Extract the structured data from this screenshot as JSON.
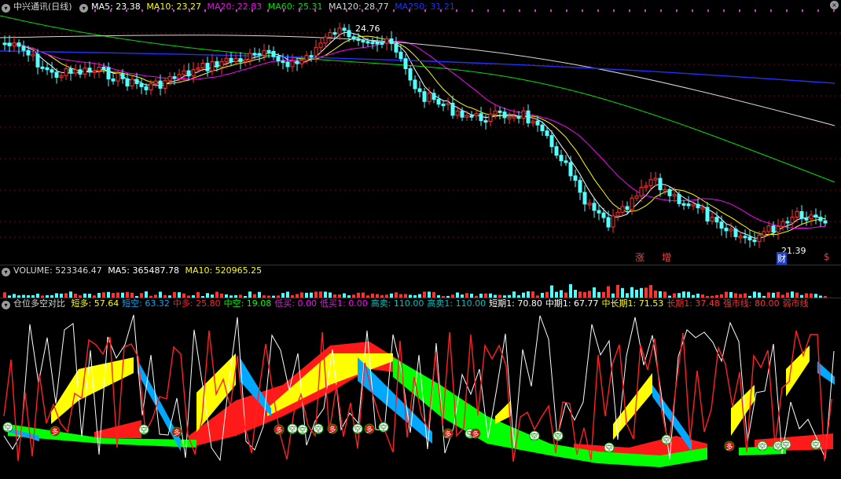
{
  "header": {
    "title": "中兴通讯(日线)",
    "ma5": "MA5: 23.38",
    "ma10": "MA10: 23.27",
    "ma20": "MA20: 22.83",
    "ma60": "MA60: 25.31",
    "ma120": "MA120: 28.77",
    "ma250": "MA250: 31.21"
  },
  "volume": {
    "vol": "VOLUME: 523346.47",
    "ma5": "MA5: 365487.78",
    "ma10": "MA10: 520965.25"
  },
  "indicator": {
    "name": "仓位多空对比",
    "items": [
      {
        "text": "短多: 57.64",
        "color": "#ffff00"
      },
      {
        "text": "短空: 63.32",
        "color": "#00a8ff"
      },
      {
        "text": "中多: 25.80",
        "color": "#ff2020"
      },
      {
        "text": "中空: 19.08",
        "color": "#00ff00"
      },
      {
        "text": "低买: 0.00",
        "color": "#ff00ff"
      },
      {
        "text": "低买1: 0.00",
        "color": "#ff00ff"
      },
      {
        "text": "高卖: 110.00",
        "color": "#00c0c0"
      },
      {
        "text": "高卖1: 110.00",
        "color": "#00c0c0"
      },
      {
        "text": "短期1: 70.80",
        "color": "#ffffff"
      },
      {
        "text": "中期1: 67.77",
        "color": "#ffffff"
      },
      {
        "text": "中长期1: 71.53",
        "color": "#ffff00"
      },
      {
        "text": "长期1: 37.48",
        "color": "#ff3030"
      },
      {
        "text": "强市线: 80.00",
        "color": "#ff3030"
      },
      {
        "text": "弱市线",
        "color": "#ff3030"
      }
    ]
  },
  "annotations": {
    "high_price": "24.76",
    "low_price": "21.39",
    "tag_zhang": "涨",
    "tag_zeng": "增",
    "tag_cai": "财",
    "tag_dollar": "$"
  },
  "signals": {
    "duo": "多",
    "kong": "空"
  },
  "colors": {
    "up": "#ff3232",
    "down": "#54ffff",
    "grid": "#7a0000",
    "bg": "#000000"
  },
  "chart_data": [
    {
      "type": "candlestick",
      "title": "中兴通讯(日线)",
      "ylim": [
        20.5,
        25.5
      ],
      "series_names": [
        "MA5",
        "MA10",
        "MA20",
        "MA60",
        "MA120",
        "MA250"
      ],
      "note_values": {
        "high": 24.76,
        "low": 21.39
      }
    },
    {
      "type": "bar",
      "title": "VOLUME",
      "values_latest": 523346.47
    },
    {
      "type": "area",
      "title": "仓位多空对比",
      "ylim": [
        0,
        110
      ]
    }
  ]
}
